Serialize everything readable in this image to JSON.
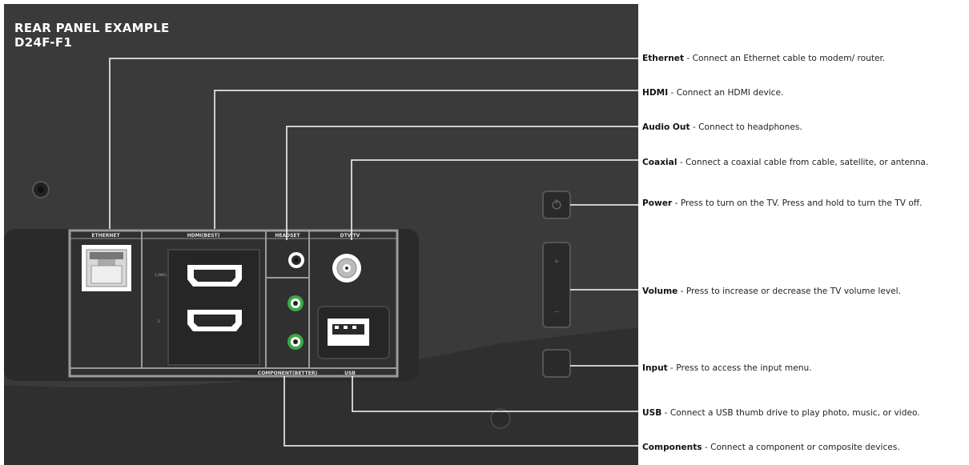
{
  "title": {
    "line1": "REAR PANEL EXAMPLE",
    "line2": "D24F-F1"
  },
  "panel_labels": {
    "ethernet": "ETHERNET",
    "hdmi": "HDMI(BEST)",
    "headset": "HEADSET",
    "dtv": "DTV/TV",
    "component": "COMPONENT(BETTER)",
    "usb": "USB"
  },
  "callouts": [
    {
      "name": "Ethernet",
      "text": "Connect an Ethernet cable to modem/ router."
    },
    {
      "name": "HDMI",
      "text": "Connect an HDMI device."
    },
    {
      "name": "Audio Out",
      "text": "Connect to headphones."
    },
    {
      "name": "Coaxial",
      "text": "Connect a coaxial cable from cable, satellite, or antenna."
    },
    {
      "name": "Power",
      "text": "Press to turn on the TV. Press and hold to turn the TV off."
    },
    {
      "name": "Volume",
      "text": "Press to increase or decrease the TV volume level."
    },
    {
      "name": "Input",
      "text": "Press to access the input menu."
    },
    {
      "name": "USB",
      "text": "Connect a USB thumb drive to play photo, music, or video."
    },
    {
      "name": "Components",
      "text": "Connect a component or composite devices."
    }
  ],
  "colors": {
    "background": "#3a3a3a",
    "leader_lines": "#ffffff",
    "jack_green": "#3ea84a",
    "panel_frame": "#9a9a9a"
  }
}
